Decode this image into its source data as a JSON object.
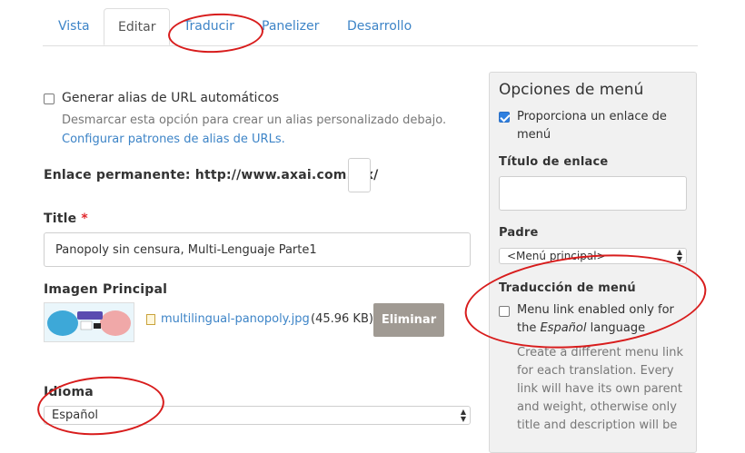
{
  "tabs": [
    {
      "label": "Vista"
    },
    {
      "label": "Editar"
    },
    {
      "label": "Traducir"
    },
    {
      "label": "Panelizer"
    },
    {
      "label": "Desarrollo"
    }
  ],
  "url_alias": {
    "checkbox_label": "Generar alias de URL automáticos",
    "description": "Desmarcar esta opción para crear un alias personalizado debajo.",
    "link": "Configurar patrones de alias de URLs."
  },
  "permalink": {
    "label": "Enlace permanente: http://www.axai.com.mx/",
    "value": ""
  },
  "title_field": {
    "label": "Title",
    "required_mark": "*",
    "value": "Panopoly sin censura, Multi-Lenguaje Parte1"
  },
  "main_image": {
    "label": "Imagen Principal",
    "file_name": "multilingual-panopoly.jpg",
    "file_size": "(45.96 KB)",
    "remove_label": "Eliminar"
  },
  "language": {
    "label": "Idioma",
    "selected": "Español"
  },
  "menu_options": {
    "heading": "Opciones de menú",
    "provide_link_label_1": "Proporciona un enlace de",
    "provide_link_label_2": "menú",
    "link_title_label": "Título de enlace",
    "link_title_value": "",
    "parent_label": "Padre",
    "parent_selected": "<Menú principal>",
    "translation_heading": "Traducción de menú",
    "translation_checkbox_1": "Menu link enabled only for",
    "translation_checkbox_2_pre": "the ",
    "translation_checkbox_2_em": "Español",
    "translation_checkbox_2_post": " language",
    "translation_desc": [
      "Create a different menu link",
      "for each translation. Every",
      "link will have its own parent",
      "and weight, otherwise only",
      "title and description will be"
    ]
  },
  "colors": {
    "link": "#3d84c7",
    "annotation": "#d81c1c",
    "remove_button": "#a09a93"
  }
}
